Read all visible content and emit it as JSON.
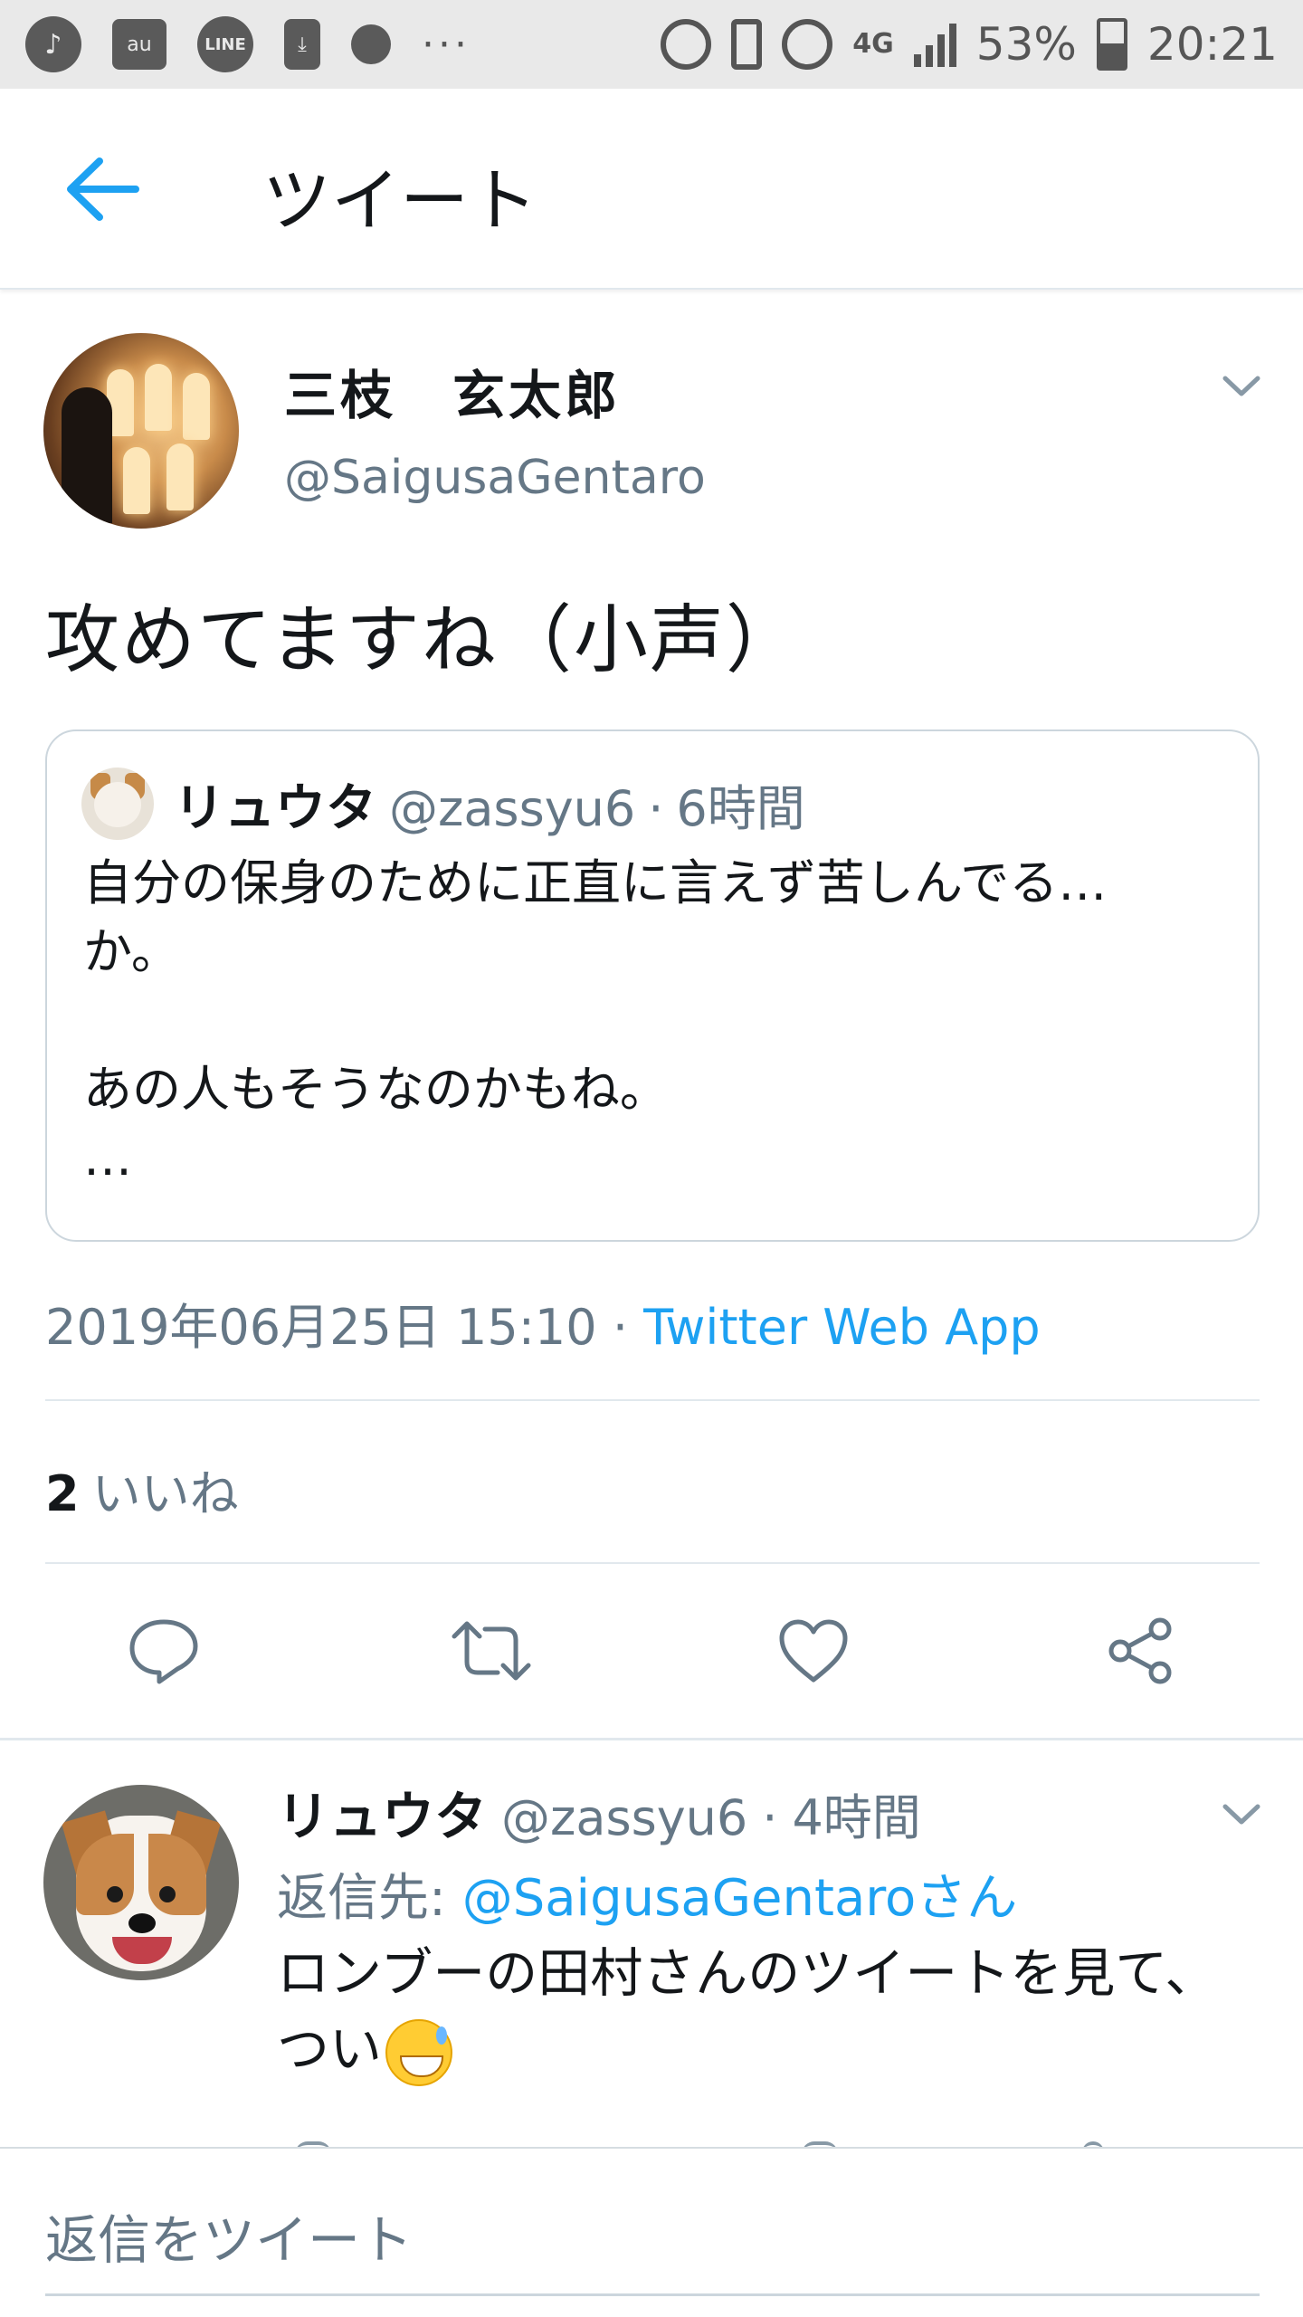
{
  "status_bar": {
    "carrier_label": "au",
    "line_label": "LINE",
    "overflow": "···",
    "network": "4G",
    "battery": "53%",
    "time": "20:21"
  },
  "header": {
    "title": "ツイート"
  },
  "tweet": {
    "display_name": "三枝　玄太郎",
    "handle": "@SaigusaGentaro",
    "text": "攻めてますね（小声）",
    "timestamp": "2019年06月25日 15:10",
    "separator": "·",
    "source": "Twitter Web App",
    "likes_count": "2",
    "likes_label": "いいね"
  },
  "quote": {
    "display_name": "リュウタ",
    "handle": "@zassyu6",
    "separator": "·",
    "age": "6時間",
    "text": "自分の保身のために正直に言えず苦しんでる…\nか。\n\nあの人もそうなのかもね。\n…"
  },
  "actions": [
    {
      "name": "reply",
      "icon": "reply-icon"
    },
    {
      "name": "retweet",
      "icon": "retweet-icon"
    },
    {
      "name": "like",
      "icon": "heart-icon"
    },
    {
      "name": "share",
      "icon": "share-icon"
    }
  ],
  "reply": {
    "display_name": "リュウタ",
    "handle": "@zassyu6",
    "separator": "·",
    "age": "4時間",
    "reply_to_prefix": "返信先:",
    "reply_to_mention": "@SaigusaGentaroさん",
    "text": "ロンブーの田村さんのツイートを見て、\nつい"
  },
  "compose": {
    "placeholder": "返信をツイート"
  },
  "colors": {
    "accent": "#1da1f2",
    "secondary_text": "#657786",
    "primary_text": "#14171a",
    "border": "#e1e8ed"
  }
}
